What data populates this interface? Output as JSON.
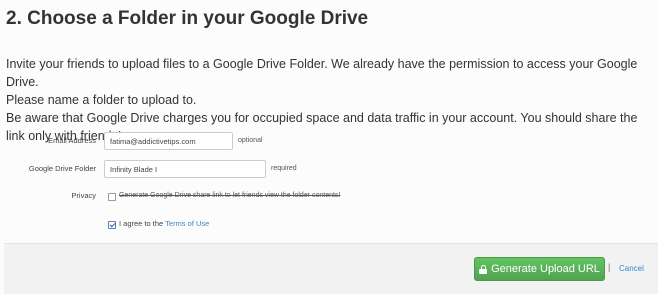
{
  "title": "2. Choose a Folder in your Google Drive",
  "description": {
    "line1": "Invite your friends to upload files to a Google Drive Folder. We already have the permission to access your Google Drive.",
    "line2": "Please name a folder to upload to.",
    "line3": "Be aware that Google Drive charges you for occupied space and data traffic in your account. You should share the link only with friends!"
  },
  "form": {
    "email": {
      "label": "Email Address",
      "value": "fatima@addictivetips.com",
      "hint": "optional"
    },
    "folder": {
      "label": "Google Drive Folder",
      "value": "Infinity Blade I",
      "hint": "required"
    },
    "privacy": {
      "label": "Privacy",
      "text": "Generate Google Drive share link to let friends view the folder contents!",
      "checked": false
    },
    "agree": {
      "prefix": "I agree to the",
      "link": "Terms of Use",
      "checked": true
    }
  },
  "footer": {
    "generate_label": "Generate Upload URL",
    "separator": "|",
    "cancel_label": "Cancel"
  },
  "colors": {
    "button_green": "#5bb75b",
    "link_blue": "#3a87c6"
  },
  "icons": {
    "generate_button": "lock-icon"
  }
}
